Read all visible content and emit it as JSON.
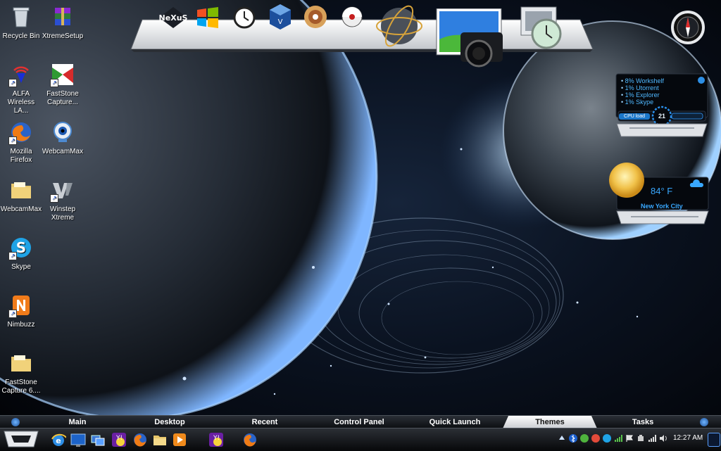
{
  "desktop_icons": [
    {
      "label": "Recycle Bin",
      "icon": "recycle-bin-icon",
      "shortcut": false
    },
    {
      "label": "XtremeSetup",
      "icon": "winrar-archive-icon",
      "shortcut": false
    },
    {
      "label": "ALFA Wireless LA...",
      "icon": "alfa-wireless-icon",
      "shortcut": true
    },
    {
      "label": "FastStone Capture...",
      "icon": "faststone-capture-icon",
      "shortcut": true
    },
    {
      "label": "Mozilla Firefox",
      "icon": "firefox-icon",
      "shortcut": true
    },
    {
      "label": "WebcamMax",
      "icon": "webcam-icon",
      "shortcut": true
    },
    {
      "label": "WebcamMax",
      "icon": "folder-icon",
      "shortcut": false
    },
    {
      "label": "Winstep Xtreme",
      "icon": "winstep-icon",
      "shortcut": true
    },
    {
      "label": "Skype",
      "icon": "skype-icon",
      "shortcut": true
    },
    {
      "label": "Nimbuzz",
      "icon": "nimbuzz-icon",
      "shortcut": true
    },
    {
      "label": "FastStone Capture 6....",
      "icon": "folder-icon",
      "shortcut": false
    }
  ],
  "dock": {
    "items": [
      {
        "name": "nexus-logo",
        "label": "NeXuS"
      },
      {
        "name": "windows-logo-icon"
      },
      {
        "name": "clock-app-icon"
      },
      {
        "name": "virtualbox-icon"
      },
      {
        "name": "dvd-disc-icon"
      },
      {
        "name": "pokeball-icon"
      },
      {
        "name": "globe-network-icon"
      },
      {
        "name": "photo-camera-icon"
      },
      {
        "name": "monitor-clock-icon"
      }
    ]
  },
  "cpu_widget": {
    "processes": [
      "8% Workshelf",
      "1% Utorrent",
      "1% Explorer",
      "1% Skype"
    ],
    "label": "CPU load",
    "value": "21"
  },
  "weather_widget": {
    "temperature": "84° F",
    "city": "New York City",
    "condition_icon": "sunny-icon"
  },
  "launcher_bar": {
    "tabs": [
      "Main",
      "Desktop",
      "Recent",
      "Control Panel",
      "Quick Launch",
      "Themes",
      "Tasks"
    ],
    "active_tab": "Themes"
  },
  "taskbar": {
    "pinned": [
      "internet-explorer-icon",
      "desktop-icon",
      "window-switcher-icon",
      "yahoo-messenger-icon",
      "firefox-icon",
      "explorer-folder-icon",
      "media-player-icon"
    ],
    "running": [
      "yahoo-messenger-icon",
      "firefox-icon"
    ],
    "clock": "12:27 AM"
  },
  "colors": {
    "widget_accent": "#39a8ff",
    "bar_dark": "#0b0d11",
    "active_tab": "#e8eaee"
  }
}
